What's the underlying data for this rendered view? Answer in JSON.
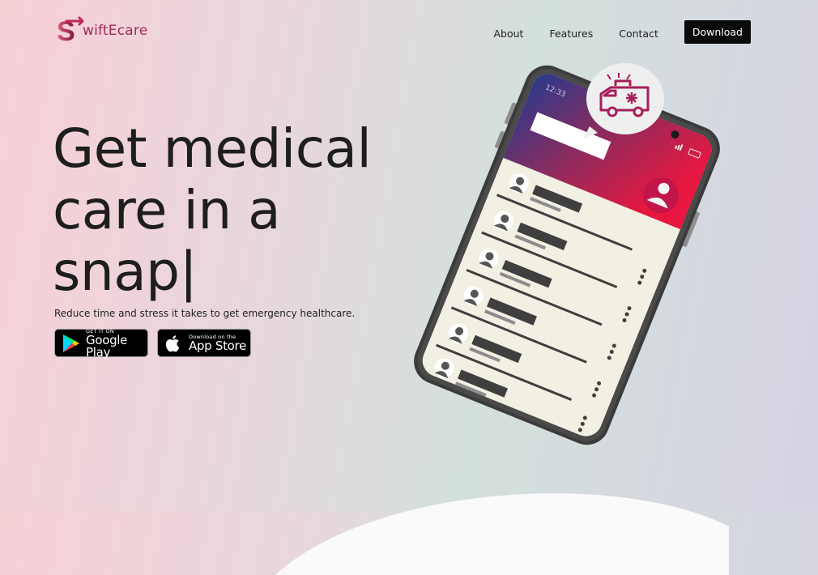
{
  "brand": {
    "name": "wiftEcare",
    "mark_letter": "S"
  },
  "nav": {
    "links": [
      "About",
      "Features",
      "Contact"
    ],
    "download_label": "Download"
  },
  "hero": {
    "title_lines": [
      "Get medical",
      "care in a",
      "snap"
    ],
    "caret": "|",
    "subtitle": "Reduce time and stress it takes to get emergency healthcare."
  },
  "store_buttons": {
    "google": {
      "small": "GET IT ON",
      "big": "Google Play"
    },
    "apple": {
      "small": "Download on the",
      "big": "App Store"
    }
  },
  "phone": {
    "time": "12:33"
  },
  "colors": {
    "brand": "#a1285a",
    "accent_red": "#e8173f",
    "accent_blue": "#283a8c"
  }
}
